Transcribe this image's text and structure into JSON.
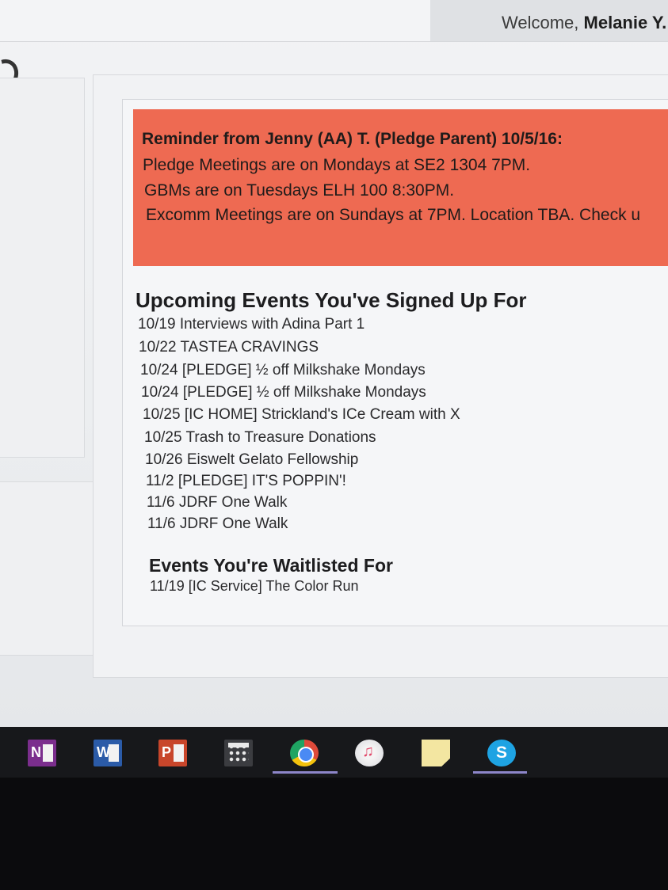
{
  "header": {
    "welcome_prefix": "Welcome, ",
    "user_name": "Melanie Y."
  },
  "reminder": {
    "title": "Reminder from Jenny (AA) T. (Pledge Parent) 10/5/16:",
    "lines": [
      "Pledge Meetings are on Mondays at SE2 1304 7PM.",
      "GBMs are on Tuesdays ELH 100 8:30PM.",
      "Excomm Meetings are on Sundays at 7PM. Location TBA. Check u"
    ],
    "background_color": "#ee6a52"
  },
  "upcoming": {
    "title": "Upcoming Events You've Signed Up For",
    "events": [
      "10/19 Interviews with Adina Part 1",
      "10/22 TASTEA CRAVINGS",
      "10/24 [PLEDGE] ½ off Milkshake Mondays",
      "10/24 [PLEDGE] ½ off Milkshake Mondays",
      "10/25 [IC HOME] Strickland's ICe Cream with X",
      "10/25 Trash to Treasure Donations",
      "10/26 Eiswelt Gelato Fellowship",
      "11/2 [PLEDGE] IT'S POPPIN'!",
      "11/6 JDRF One Walk",
      "11/6 JDRF One Walk"
    ]
  },
  "waitlisted": {
    "title": "Events You're Waitlisted For",
    "events": [
      "11/19 [IC Service] The Color Run"
    ]
  },
  "taskbar": {
    "apps": [
      {
        "icon": "onenote-icon",
        "letter": "N"
      },
      {
        "icon": "word-icon",
        "letter": "W"
      },
      {
        "icon": "powerpoint-icon",
        "letter": "P"
      },
      {
        "icon": "calculator-icon"
      },
      {
        "icon": "chrome-icon"
      },
      {
        "icon": "itunes-icon"
      },
      {
        "icon": "sticky-notes-icon"
      },
      {
        "icon": "skype-icon"
      }
    ]
  }
}
